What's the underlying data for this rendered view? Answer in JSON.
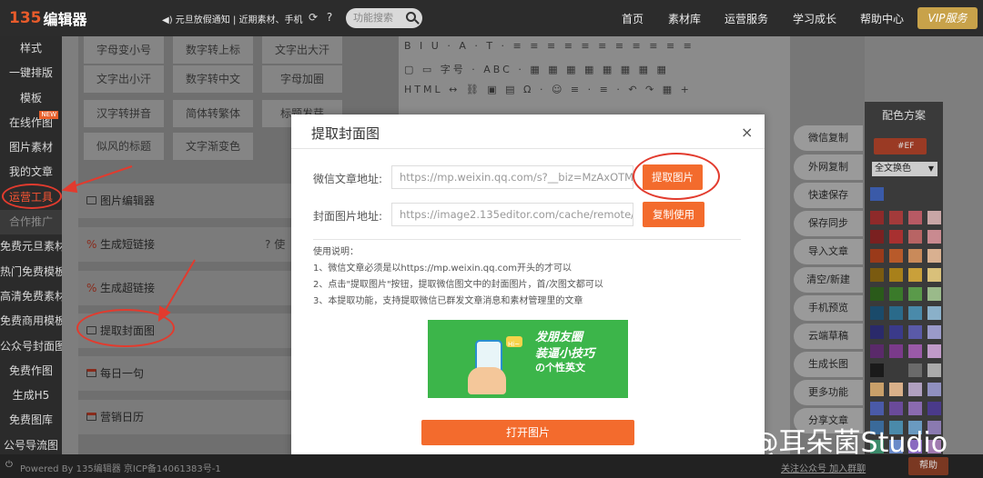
{
  "topbar": {
    "logo_num": "135",
    "logo_text": "编辑器",
    "notice": "◀) 元旦放假通知 | 近期素材、手机",
    "search_placeholder": "功能搜索",
    "nav": [
      "首页",
      "素材库",
      "运营服务",
      "学习成长",
      "帮助中心"
    ],
    "vip": "VIP服务"
  },
  "sidebar": {
    "items": [
      "样式",
      "一键排版",
      "模板",
      "在线作图",
      "图片素材",
      "我的文章",
      "运营工具",
      "合作推广",
      "免费元旦素材",
      "热门免费模板",
      "高清免费素材",
      "免费商用模板",
      "公众号封面图",
      "免费作图",
      "生成H5",
      "免费图库",
      "公号导流图"
    ],
    "new_tag": "NEW"
  },
  "tools": {
    "grid": [
      "字母变小号",
      "数字转上标",
      "文字出大汗",
      "文字出小汗",
      "数字转中文",
      "字母加圈",
      "汉字转拼音",
      "简体转繁体",
      "标题发芽",
      "似风的标题",
      "文字渐变色"
    ],
    "rows": [
      "图片编辑器",
      "生成短链接",
      "生成超链接",
      "提取封面图",
      "每日一句",
      "营销日历"
    ],
    "short_link_hint": "使"
  },
  "editor": {
    "toolbar_rows": [
      "B I U · A · T · ≡ ≡ ≡ ≡ ≡ ≡ ≡ ≡ ≡ ≡ ≡",
      "▢ ▭  字号 · ABC · ▦ ▦ ▦ ▦ ▦ ▦ ▦ ▦",
      "HTML ↔ ⛓ ▣ ▤ Ω · ☺ ≡ · ≡ · ↶ ↷ ▦ +"
    ]
  },
  "right_column": {
    "buttons": [
      "微信复制",
      "外网复制",
      "快速保存",
      "保存同步",
      "导入文章",
      "清空/新建",
      "手机预览",
      "云端草稿",
      "生成长图",
      "更多功能",
      "分享文章"
    ]
  },
  "palette": {
    "title": "配色方案",
    "ef_label": "#EF",
    "select_label": "全文换色",
    "colors": [
      [
        "#8e2a2a",
        "#a33a3a",
        "#b85a64",
        "#c9a6a6"
      ],
      [
        "#7a2020",
        "#a83030",
        "#b86464",
        "#c98a90"
      ],
      [
        "#9a3a1a",
        "#b85a2a",
        "#c98a5a",
        "#d9b090"
      ],
      [
        "#7a5a10",
        "#a8801a",
        "#c9a03a",
        "#d9c07a"
      ],
      [
        "#2a5a1a",
        "#3a7a2a",
        "#5a9a4a",
        "#9aba8a"
      ],
      [
        "#1a4a6a",
        "#2a6a8a",
        "#4a8aaa",
        "#8ab0c9"
      ],
      [
        "#2a2a6a",
        "#3a3a8a",
        "#5a5aa8",
        "#9a9ac9"
      ],
      [
        "#5a2a6a",
        "#7a3a8a",
        "#9a5aa8",
        "#c09ac9"
      ],
      [
        "#1a1a1a",
        "#3a3a3a",
        "#6a6a6a",
        "#aaaaaa"
      ],
      [
        "#c9a06a",
        "#d9b08a",
        "#b0a0c0",
        "#9090c0"
      ],
      [
        "#4a5aa8",
        "#6a4a9a",
        "#8a6ab0",
        "#4a3a8a"
      ],
      [
        "#3a6a9a",
        "#4a8aaa",
        "#6a9ac0",
        "#8a7ab0"
      ],
      [
        "#3a8a6a",
        "#6a8ac9",
        "#8a6ac0",
        "#a07ab0"
      ]
    ]
  },
  "modal": {
    "title": "提取封面图",
    "close": "×",
    "article_label": "微信文章地址:",
    "article_value": "https://mp.weixin.qq.com/s?__biz=MzAxOTMzM",
    "extract_btn": "提取图片",
    "cover_label": "封面图片地址:",
    "cover_value": "https://image2.135editor.com/cache/remote/aHR",
    "copy_btn": "复制使用",
    "help_title": "使用说明：",
    "help_lines": [
      "1、微信文章必须是以https://mp.weixin.qq.com开头的才可以",
      "2、点击\"提取图片\"按钮，提取微信图文中的封面图片，首/次图文都可以",
      "3、本提取功能，支持提取微信已群发文章消息和素材管理里的文章"
    ],
    "banner_lines": [
      "发朋友圈",
      "装逼小技巧",
      "の个性英文"
    ],
    "banner_bubble": "Hi~",
    "open_btn": "打开图片"
  },
  "footer": {
    "powered": "Powered By 135编辑器 京ICP备14061383号-1",
    "links": "关注公众号  加入群聊",
    "help": "帮助"
  },
  "watermark": "知乎 @耳朵菌Studio"
}
